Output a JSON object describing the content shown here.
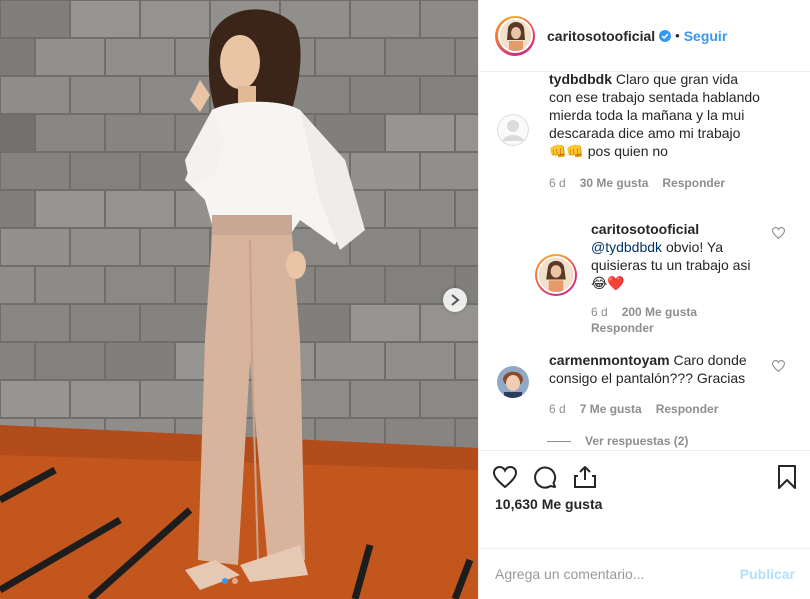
{
  "post": {
    "username": "caritosotooficial",
    "separator": "•",
    "follow_label": "Seguir",
    "likes": "10,630 Me gusta",
    "comment_placeholder": "Agrega un comentario...",
    "publish_label": "Publicar"
  },
  "comments": [
    {
      "user": "tydbdbdk",
      "text": "Claro que gran vida con ese trabajo sentada hablando mierda toda la mañana y la mui descarada dice amo mi trabajo",
      "emoji_suffix": "👊👊",
      "text_end": "pos quien no",
      "time": "6 d",
      "likes": "30 Me gusta",
      "reply": "Responder"
    },
    {
      "user": "caritosotooficial",
      "mention": "@tydbdbdk",
      "text": "obvio! Ya quisieras tu un trabajo asi",
      "emoji_suffix": "😂❤️",
      "time": "6 d",
      "likes": "200 Me gusta",
      "reply": "Responder"
    },
    {
      "user": "carmenmontoyam",
      "text": "Caro donde consigo el pantalón??? Gracias",
      "time": "6 d",
      "likes": "7 Me gusta",
      "reply": "Responder",
      "view_replies": "Ver respuestas (2)"
    }
  ],
  "carousel": {
    "total": 2,
    "active": 0
  },
  "colors": {
    "link": "#3897f0",
    "meta": "#8e8e8e",
    "publish_disabled": "#b2dffc",
    "mention": "#003569"
  },
  "icons": [
    "verified-badge-icon",
    "heart-icon",
    "comment-icon",
    "share-icon",
    "bookmark-icon",
    "chevron-right-icon"
  ]
}
